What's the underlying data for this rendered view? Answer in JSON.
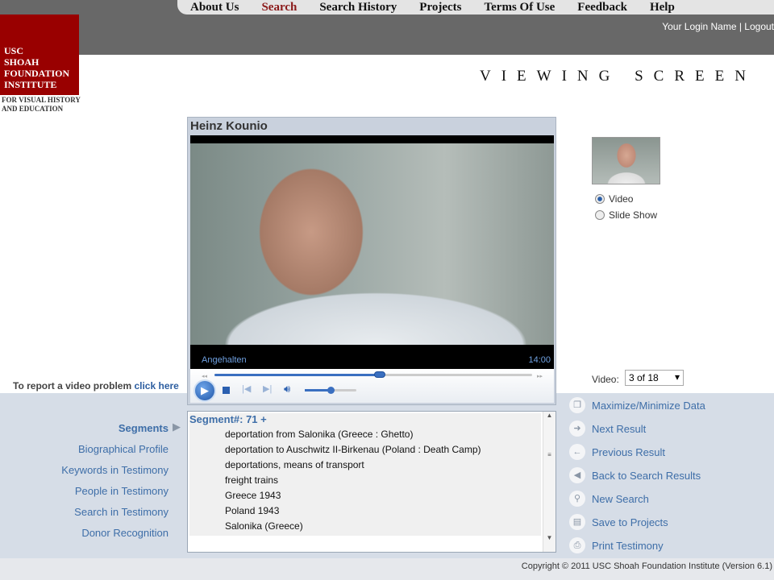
{
  "nav": [
    "About Us",
    "Search",
    "Search History",
    "Projects",
    "Terms Of Use",
    "Feedback",
    "Help"
  ],
  "nav_active": "Search",
  "login": {
    "name": "Your Login Name",
    "sep": " | ",
    "logout": "Logout"
  },
  "logo": {
    "lines": [
      "USC",
      "SHOAH",
      "FOUNDATION",
      "INSTITUTE"
    ],
    "sub1": "FOR VISUAL HISTORY",
    "sub2": "AND EDUCATION"
  },
  "page_title": "VIEWING SCREEN",
  "player": {
    "title": "Heinz Kounio",
    "status": "Angehalten",
    "time": "14:00",
    "progress": 0.52,
    "volume": 0.5
  },
  "report": {
    "text": "To report a video problem ",
    "link": "click here"
  },
  "view_mode": {
    "options": [
      "Video",
      "Slide Show"
    ],
    "selected": "Video"
  },
  "video_select": {
    "label": "Video:",
    "value": "3 of 18"
  },
  "left_menu": [
    "Segments",
    "Biographical Profile",
    "Keywords in Testimony",
    "People in Testimony",
    "Search in Testimony",
    "Donor Recognition"
  ],
  "segment": {
    "header": "Segment#: 71 +",
    "keywords": [
      "deportation from Salonika (Greece : Ghetto)",
      "deportation to Auschwitz II-Birkenau (Poland : Death Camp)",
      "deportations, means of transport",
      "freight trains",
      "Greece 1943",
      "Poland 1943",
      "Salonika (Greece)"
    ]
  },
  "actions": [
    {
      "label": "Maximize/Minimize Data",
      "icon": "window-icon"
    },
    {
      "label": "Next Result",
      "icon": "arrow-right-icon"
    },
    {
      "label": "Previous Result",
      "icon": "arrow-left-icon"
    },
    {
      "label": "Back to Search Results",
      "icon": "triangle-left-icon"
    },
    {
      "label": "New Search",
      "icon": "magnifier-icon"
    },
    {
      "label": "Save to Projects",
      "icon": "document-icon"
    },
    {
      "label": "Print Testimony",
      "icon": "printer-icon"
    }
  ],
  "footer": "Copyright © 2011 USC Shoah Foundation Institute (Version 6.1)",
  "colors": {
    "brand": "#990000",
    "link": "#3e6ea8",
    "panel": "#d6dde7"
  }
}
